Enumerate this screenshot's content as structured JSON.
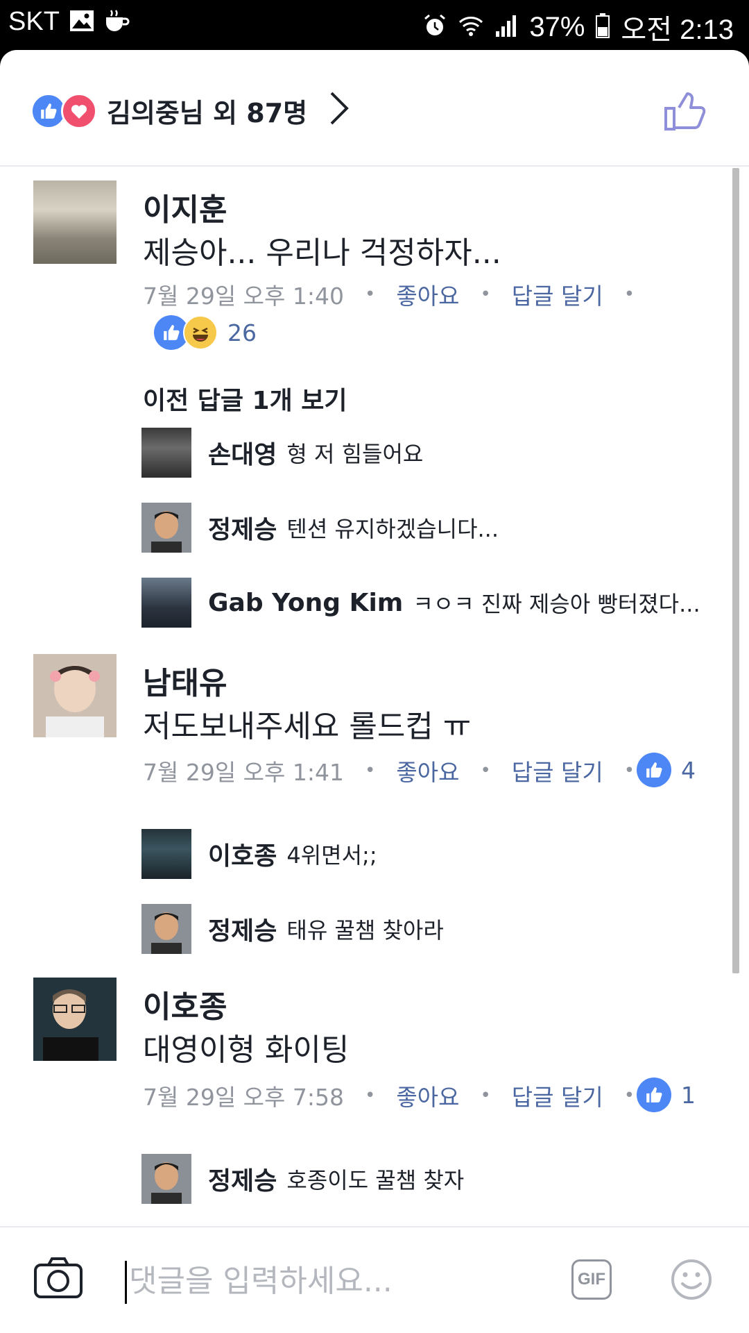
{
  "status_bar": {
    "carrier": "SKT",
    "battery": "37%",
    "time": "오전 2:13"
  },
  "reactions_header": {
    "label": "김의중님 외 87명"
  },
  "comments": [
    {
      "author": "이지훈",
      "text": "제승아... 우리나 걱정하자...",
      "time": "7월 29일 오후 1:40",
      "like_label": "좋아요",
      "reply_label": "답글 달기",
      "reaction_count": "26",
      "prev_replies": "이전 답글 1개 보기",
      "replies": [
        {
          "author": "손대영",
          "text": "형 저 힘들어요"
        },
        {
          "author": "정제승",
          "text": "텐션 유지하겠습니다..."
        },
        {
          "author": "Gab Yong Kim",
          "text": "ㅋㅇㅋ  진짜 제승아 빵터졌다..."
        }
      ]
    },
    {
      "author": "남태유",
      "text": "저도보내주세요 롤드컵 ㅠ",
      "time": "7월 29일 오후 1:41",
      "like_label": "좋아요",
      "reply_label": "답글 달기",
      "reaction_count": "4",
      "replies": [
        {
          "author": "이호종",
          "text": "4위면서;;"
        },
        {
          "author": "정제승",
          "text": "태유 꿀챔 찾아라"
        }
      ]
    },
    {
      "author": "이호종",
      "text": "대영이형 화이팅",
      "time": "7월 29일 오후 7:58",
      "like_label": "좋아요",
      "reply_label": "답글 달기",
      "reaction_count": "1",
      "replies": [
        {
          "author": "정제승",
          "text": "호종이도 꿀챔 찾자"
        }
      ]
    }
  ],
  "composer": {
    "placeholder": "댓글을 입력하세요...",
    "gif_label": "GIF"
  },
  "colors": {
    "accent_blue": "#4d87f6",
    "link_blue": "#4b67a1",
    "love_red": "#f0506e",
    "meta_gray": "#90949c"
  }
}
